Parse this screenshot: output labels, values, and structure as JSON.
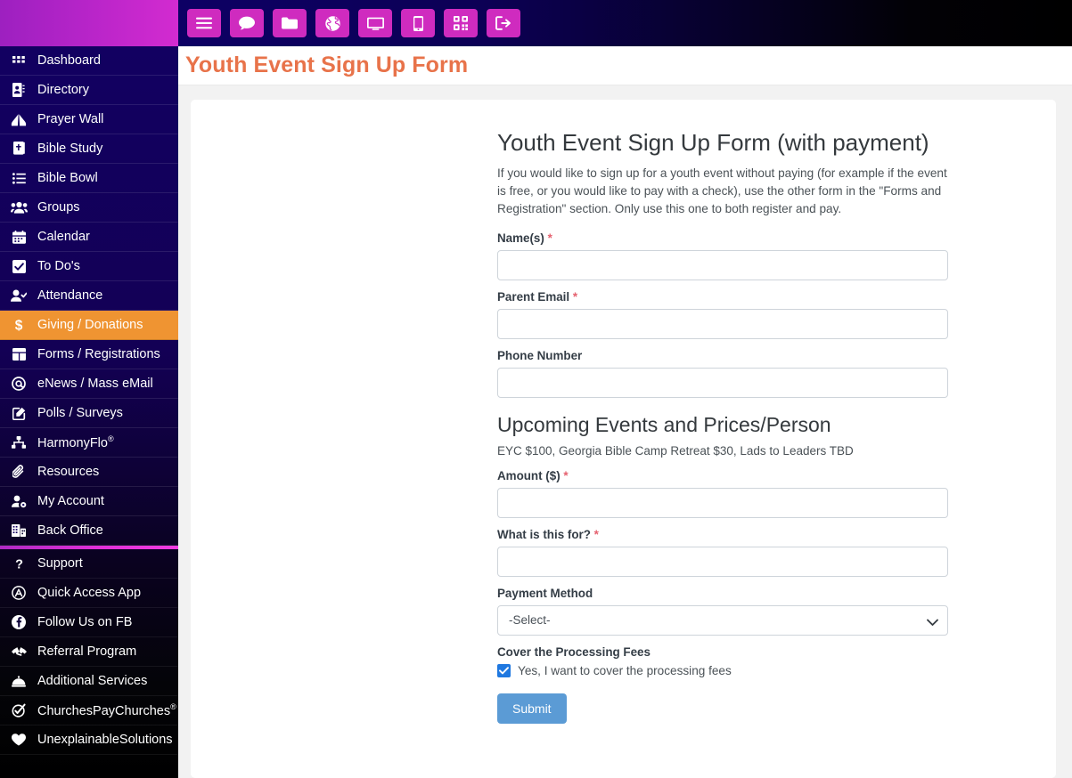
{
  "colors": {
    "sidebar_bg": "#120063",
    "brand_gradient_start": "#9d20c0",
    "brand_gradient_end": "#d32bd0",
    "active_item": "#ef9432",
    "toolbar_button": "#cf2bbf",
    "page_title": "#e8734a",
    "submit_button": "#5b9bd5",
    "required_asterisk": "#e5616f",
    "checkbox_checked": "#1f78e0"
  },
  "toolbar": {
    "buttons": [
      {
        "name": "menu-icon",
        "label": "Menu"
      },
      {
        "name": "chat-icon",
        "label": "Chat"
      },
      {
        "name": "folder-icon",
        "label": "Files"
      },
      {
        "name": "globe-icon",
        "label": "Website"
      },
      {
        "name": "monitor-icon",
        "label": "Desktop"
      },
      {
        "name": "mobile-icon",
        "label": "Mobile"
      },
      {
        "name": "qrcode-icon",
        "label": "QR Code"
      },
      {
        "name": "logout-icon",
        "label": "Log Out"
      }
    ]
  },
  "sidebar": {
    "primary_items": [
      {
        "label": "Dashboard",
        "icon": "grid-icon",
        "active": false
      },
      {
        "label": "Directory",
        "icon": "address-book-icon",
        "active": false
      },
      {
        "label": "Prayer Wall",
        "icon": "praying-hands-icon",
        "active": false
      },
      {
        "label": "Bible Study",
        "icon": "bible-icon",
        "active": false
      },
      {
        "label": "Bible Bowl",
        "icon": "list-icon",
        "active": false
      },
      {
        "label": "Groups",
        "icon": "users-icon",
        "active": false
      },
      {
        "label": "Calendar",
        "icon": "calendar-icon",
        "active": false
      },
      {
        "label": "To Do's",
        "icon": "checkbox-icon",
        "active": false
      },
      {
        "label": "Attendance",
        "icon": "user-check-icon",
        "active": false
      },
      {
        "label": "Giving / Donations",
        "icon": "dollar-icon",
        "active": true
      },
      {
        "label": "Forms / Registrations",
        "icon": "table-icon",
        "active": false
      },
      {
        "label": "eNews / Mass eMail",
        "icon": "at-icon",
        "active": false
      },
      {
        "label": "Polls / Surveys",
        "icon": "pen-square-icon",
        "active": false
      },
      {
        "label": "HarmonyFlo",
        "suffix": "®",
        "icon": "sitemap-icon",
        "active": false
      },
      {
        "label": "Resources",
        "icon": "paperclip-icon",
        "active": false
      },
      {
        "label": "My Account",
        "icon": "user-cog-icon",
        "active": false
      },
      {
        "label": "Back Office",
        "icon": "building-icon",
        "active": false
      }
    ],
    "secondary_items": [
      {
        "label": "Support",
        "icon": "question-mark-icon"
      },
      {
        "label": "Quick Access App",
        "icon": "circle-a-icon"
      },
      {
        "label": "Follow Us on FB",
        "icon": "facebook-icon"
      },
      {
        "label": "Referral Program",
        "icon": "handshake-icon"
      },
      {
        "label": "Additional Services",
        "icon": "concierge-bell-icon"
      },
      {
        "label": "ChurchesPayChurches",
        "suffix": "®",
        "icon": "check-badge-icon"
      },
      {
        "label": "UnexplainableSolutions",
        "icon": "heart-icon"
      }
    ]
  },
  "header": {
    "page_title": "Youth Event Sign Up Form"
  },
  "form": {
    "title": "Youth Event Sign Up Form (with payment)",
    "description": "If you would like to sign up for a youth event without paying (for example if the event is free, or you would like to pay with a check), use the other form in the \"Forms and Registration\" section. Only use this one to both register and pay.",
    "fields": {
      "names": {
        "label": "Name(s)",
        "required": true,
        "value": "",
        "placeholder": ""
      },
      "parent_email": {
        "label": "Parent Email",
        "required": true,
        "value": "",
        "placeholder": ""
      },
      "phone_number": {
        "label": "Phone Number",
        "required": false,
        "value": "",
        "placeholder": ""
      },
      "amount": {
        "label": "Amount ($)",
        "required": true,
        "value": "",
        "placeholder": ""
      },
      "what_is_this_for": {
        "label": "What is this for?",
        "required": true,
        "value": "",
        "placeholder": ""
      },
      "payment_method": {
        "label": "Payment Method",
        "required": false,
        "selected": "-Select-",
        "options": [
          "-Select-"
        ]
      }
    },
    "events_section": {
      "title": "Upcoming Events and Prices/Person",
      "subtitle": "EYC $100, Georgia Bible Camp Retreat $30, Lads to Leaders TBD"
    },
    "processing_fees": {
      "label": "Cover the Processing Fees",
      "checkbox_label": "Yes, I want to cover the processing fees",
      "checked": true
    },
    "submit_label": "Submit",
    "required_marker": "*"
  }
}
